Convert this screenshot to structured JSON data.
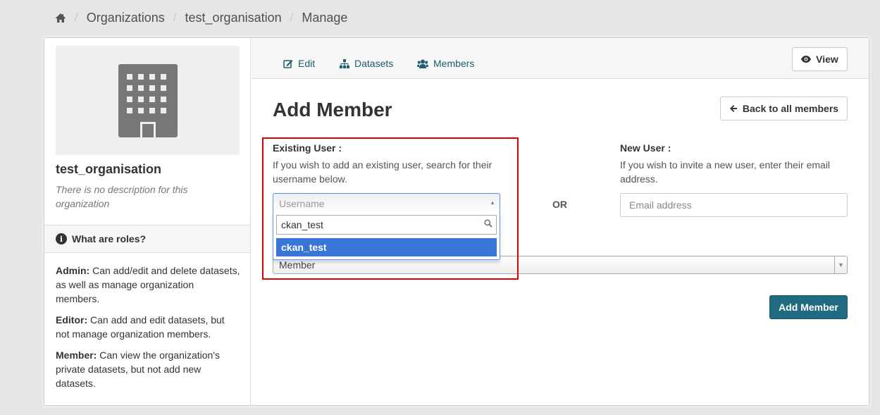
{
  "breadcrumb": {
    "items": [
      "Organizations",
      "test_organisation",
      "Manage"
    ]
  },
  "sidebar": {
    "org_title": "test_organisation",
    "org_description": "There is no description for this organization",
    "roles_heading": "What are roles?",
    "roles": [
      {
        "name": "Admin:",
        "text": " Can add/edit and delete datasets, as well as manage organization members."
      },
      {
        "name": "Editor:",
        "text": " Can add and edit datasets, but not manage organization members."
      },
      {
        "name": "Member:",
        "text": " Can view the organization's private datasets, but not add new datasets."
      }
    ]
  },
  "tabs": {
    "edit": "Edit",
    "datasets": "Datasets",
    "members": "Members",
    "view": "View"
  },
  "main": {
    "heading": "Add Member",
    "back_button": "Back to all members",
    "existing_user": {
      "label": "Existing User :",
      "help": "If you wish to add an existing user, search for their username below.",
      "select_placeholder": "Username",
      "search_value": "ckan_test",
      "result": "ckan_test"
    },
    "or_text": "OR",
    "new_user": {
      "label": "New User :",
      "help": "If you wish to invite a new user, enter their email address.",
      "email_placeholder": "Email address"
    },
    "role_select_value": "Member",
    "submit_button": "Add Member"
  },
  "colors": {
    "accent": "#206b82",
    "link": "#1f5f6e",
    "highlight": "#e00000",
    "selected_result": "#3875d7"
  },
  "icons": {
    "home": "home-icon",
    "edit": "edit-icon",
    "datasets": "sitemap-icon",
    "members": "users-icon",
    "view": "eye-icon",
    "back": "arrow-left-icon",
    "info": "info-circle-icon",
    "search": "search-icon",
    "org_placeholder": "building-icon"
  }
}
